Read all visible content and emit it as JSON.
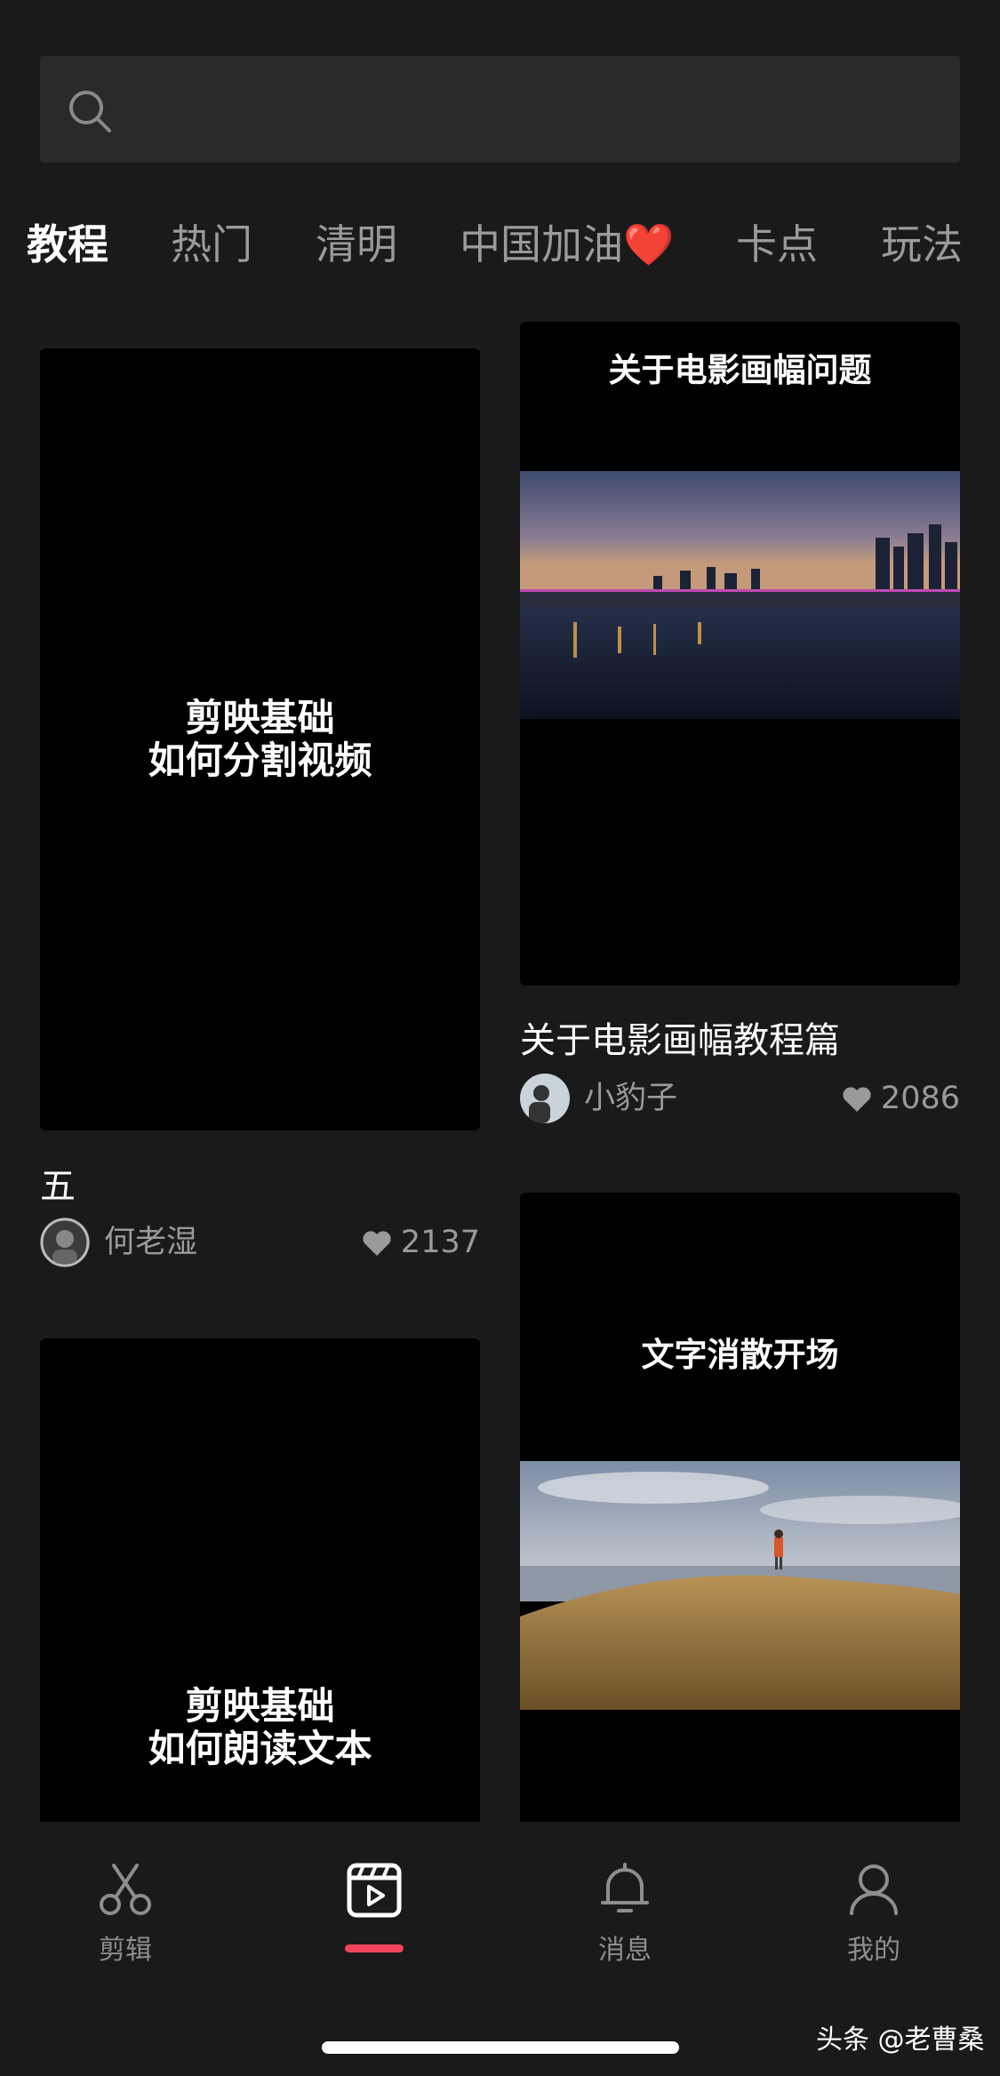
{
  "search": {
    "placeholder": ""
  },
  "tabs": [
    {
      "label": "教程"
    },
    {
      "label": "热门"
    },
    {
      "label": "清明"
    },
    {
      "label": "中国加油❤️"
    },
    {
      "label": "卡点"
    },
    {
      "label": "玩法"
    }
  ],
  "cards": [
    {
      "thumb_text": "剪映基础\n如何分割视频",
      "title": "五",
      "author": "何老湿",
      "likes": "2137"
    },
    {
      "thumb_banner": "关于电影画幅问题",
      "title": "关于电影画幅教程篇",
      "author": "小豹子",
      "likes": "2086"
    },
    {
      "thumb_text": "剪映基础\n如何朗读文本"
    },
    {
      "thumb_banner": "文字消散开场"
    }
  ],
  "nav": [
    {
      "label": "剪辑",
      "icon": "scissors-icon"
    },
    {
      "label": "",
      "icon": "template-play-icon"
    },
    {
      "label": "消息",
      "icon": "bell-icon"
    },
    {
      "label": "我的",
      "icon": "user-icon"
    }
  ],
  "watermark": "头条 @老曹桑",
  "colors": {
    "accent": "#f0455c",
    "background": "#1a1a1a"
  }
}
